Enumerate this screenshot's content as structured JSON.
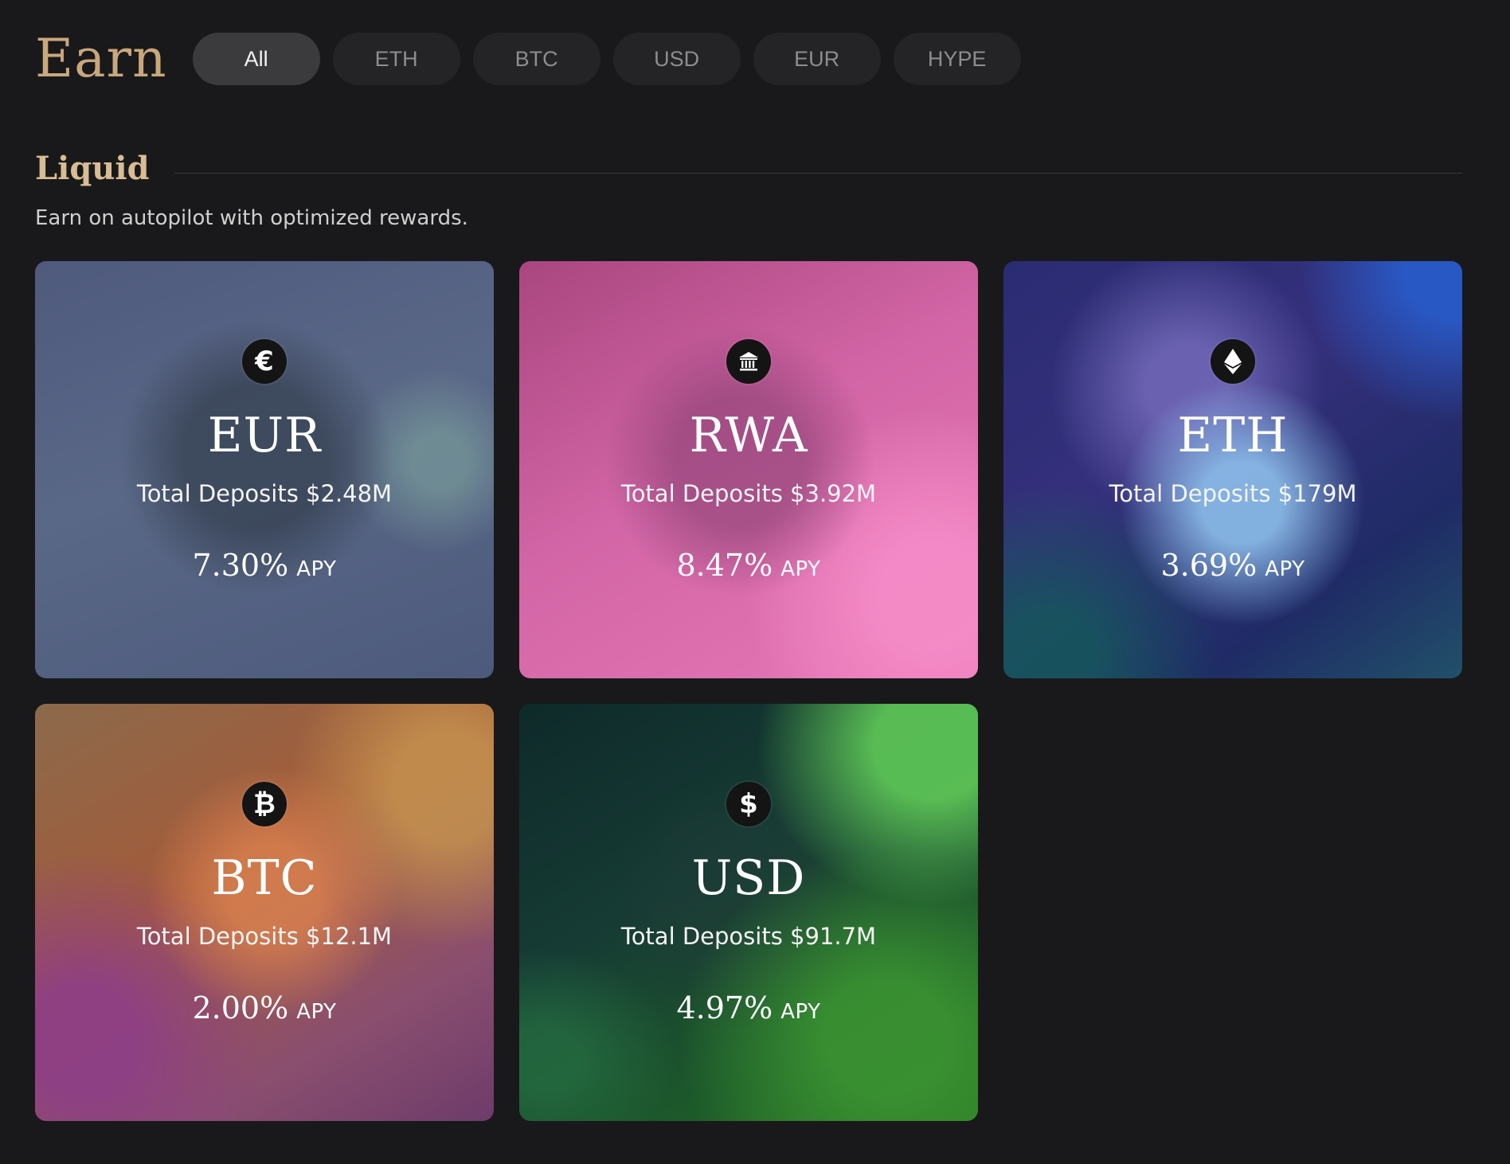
{
  "header": {
    "title": "Earn",
    "tabs": [
      {
        "label": "All",
        "active": true
      },
      {
        "label": "ETH",
        "active": false
      },
      {
        "label": "BTC",
        "active": false
      },
      {
        "label": "USD",
        "active": false
      },
      {
        "label": "EUR",
        "active": false
      },
      {
        "label": "HYPE",
        "active": false
      }
    ]
  },
  "section": {
    "title": "Liquid",
    "subtitle": "Earn on autopilot with optimized rewards."
  },
  "cards": [
    {
      "name": "EUR",
      "deposits": "Total Deposits $2.48M",
      "apy": "7.30%",
      "apy_label": "APY",
      "icon": "euro-icon",
      "glyph": "€"
    },
    {
      "name": "RWA",
      "deposits": "Total Deposits $3.92M",
      "apy": "8.47%",
      "apy_label": "APY",
      "icon": "bank-icon",
      "glyph": ""
    },
    {
      "name": "ETH",
      "deposits": "Total Deposits $179M",
      "apy": "3.69%",
      "apy_label": "APY",
      "icon": "ethereum-icon",
      "glyph": ""
    },
    {
      "name": "BTC",
      "deposits": "Total Deposits $12.1M",
      "apy": "2.00%",
      "apy_label": "APY",
      "icon": "bitcoin-icon",
      "glyph": "₿"
    },
    {
      "name": "USD",
      "deposits": "Total Deposits $91.7M",
      "apy": "4.97%",
      "apy_label": "APY",
      "icon": "dollar-icon",
      "glyph": "$"
    }
  ]
}
